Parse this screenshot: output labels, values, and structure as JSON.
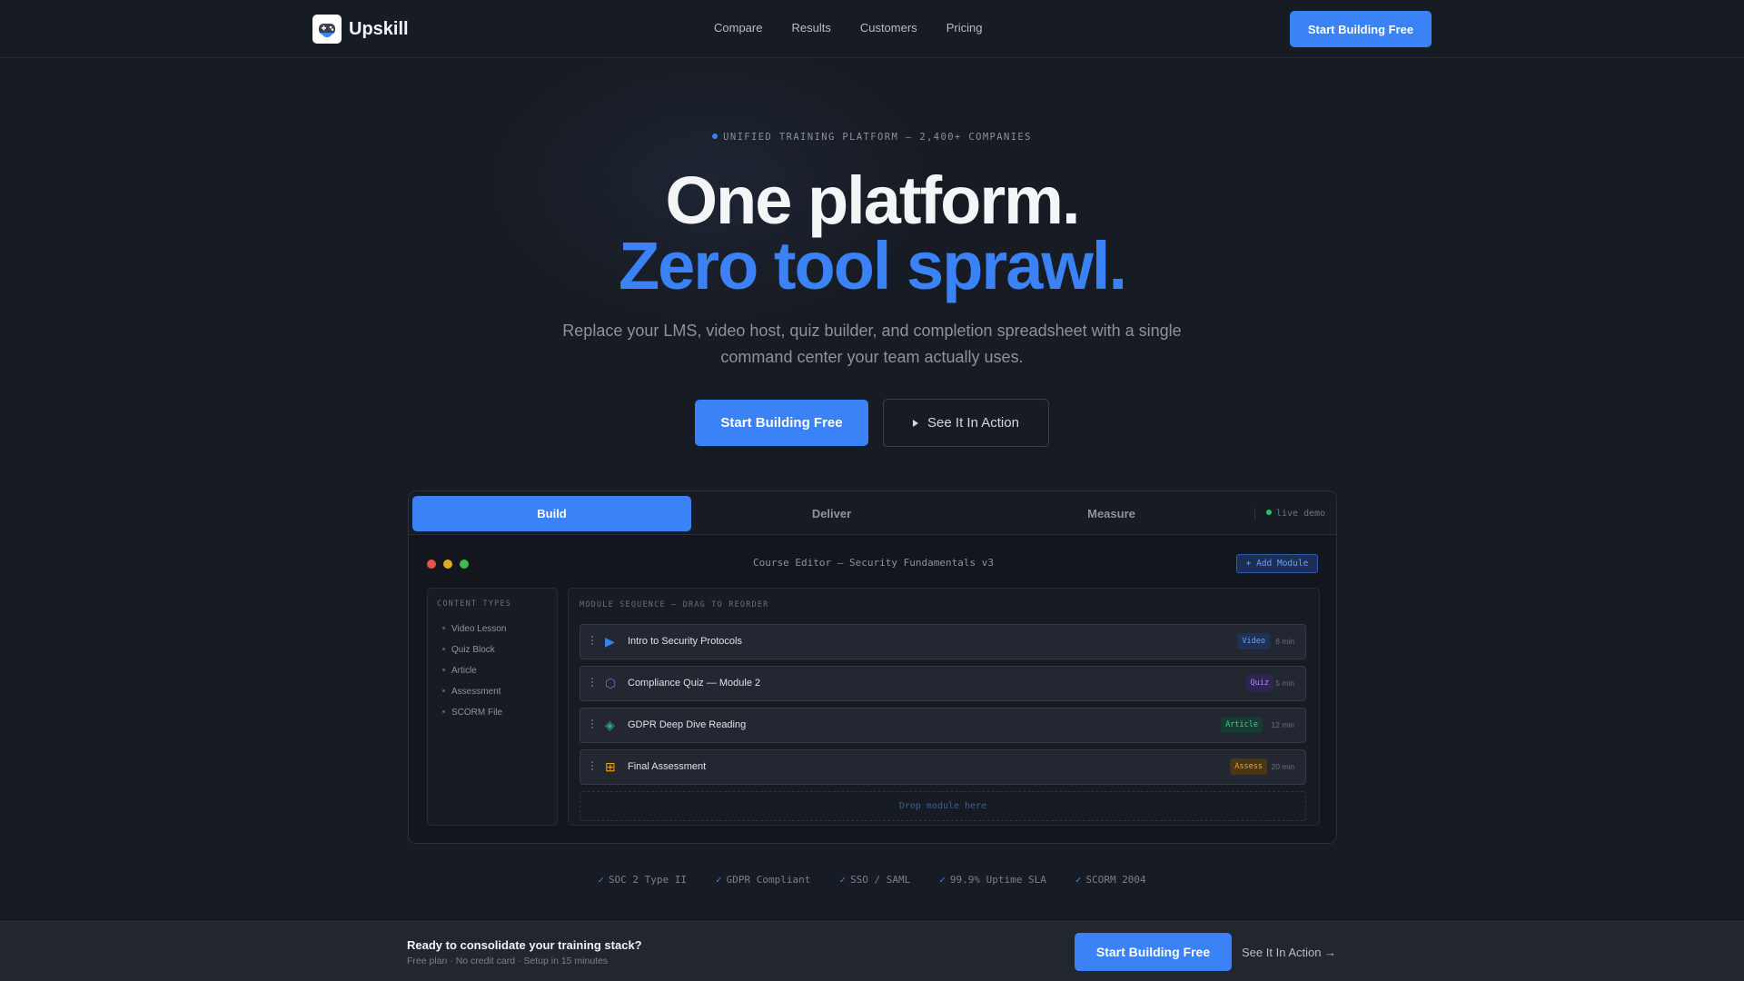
{
  "nav": {
    "brand": "Upskill",
    "logo_icon": "gamepad-icon",
    "links": [
      "Compare",
      "Results",
      "Customers",
      "Pricing"
    ],
    "cta": "Start Building Free"
  },
  "hero": {
    "eyebrow": "UNIFIED TRAINING PLATFORM — 2,400+ COMPANIES",
    "headline_1": "One platform.",
    "headline_2": "Zero tool sprawl.",
    "subtitle": "Replace your LMS, video host, quiz builder, and completion spreadsheet with a single command center your team actually uses.",
    "primary_cta": "Start Building Free",
    "secondary_cta": "See It In Action"
  },
  "demo": {
    "tabs": [
      "Build",
      "Deliver",
      "Measure"
    ],
    "active_tab": "Build",
    "live_label": "live demo",
    "editor_title": "Course Editor — Security Fundamentals v3",
    "add_module": "+ Add Module",
    "content_types_heading": "CONTENT TYPES",
    "content_types": [
      "Video Lesson",
      "Quiz Block",
      "Article",
      "Assessment",
      "SCORM File"
    ],
    "sequence_heading": "MODULE SEQUENCE — DRAG TO REORDER",
    "modules": [
      {
        "name": "Intro to Security Protocols",
        "badge": "Video",
        "duration": "8 min",
        "icon": "play-icon",
        "glyph": "▶",
        "color": "#3b82f6",
        "badge_bg": "#1e3257",
        "badge_fg": "#6ea0f7"
      },
      {
        "name": "Compliance Quiz — Module 2",
        "badge": "Quiz",
        "duration": "5 min",
        "icon": "hexagon-icon",
        "glyph": "⬡",
        "color": "#8b5cf6",
        "badge_bg": "#2f2553",
        "badge_fg": "#a78bfa"
      },
      {
        "name": "GDPR Deep Dive Reading",
        "badge": "Article",
        "duration": "12 min",
        "icon": "diamond-icon",
        "glyph": "◈",
        "color": "#10b981",
        "badge_bg": "#163b33",
        "badge_fg": "#34d399"
      },
      {
        "name": "Final Assessment",
        "badge": "Assess",
        "duration": "20 min",
        "icon": "grid-icon",
        "glyph": "⊞",
        "color": "#f59e0b",
        "badge_bg": "#4a3514",
        "badge_fg": "#f5a524"
      }
    ],
    "drop_zone": "Drop module here"
  },
  "trust": [
    "SOC 2 Type II",
    "GDPR Compliant",
    "SSO / SAML",
    "99.9% Uptime SLA",
    "SCORM 2004"
  ],
  "footer_bar": {
    "title": "Ready to consolidate your training stack?",
    "subtitle": "Free plan · No credit card · Setup in 15 minutes",
    "cta": "Start Building Free",
    "link": "See It In Action →"
  },
  "colors": {
    "accent": "#3b82f6",
    "background": "#171b23",
    "live": "#22c55e"
  }
}
